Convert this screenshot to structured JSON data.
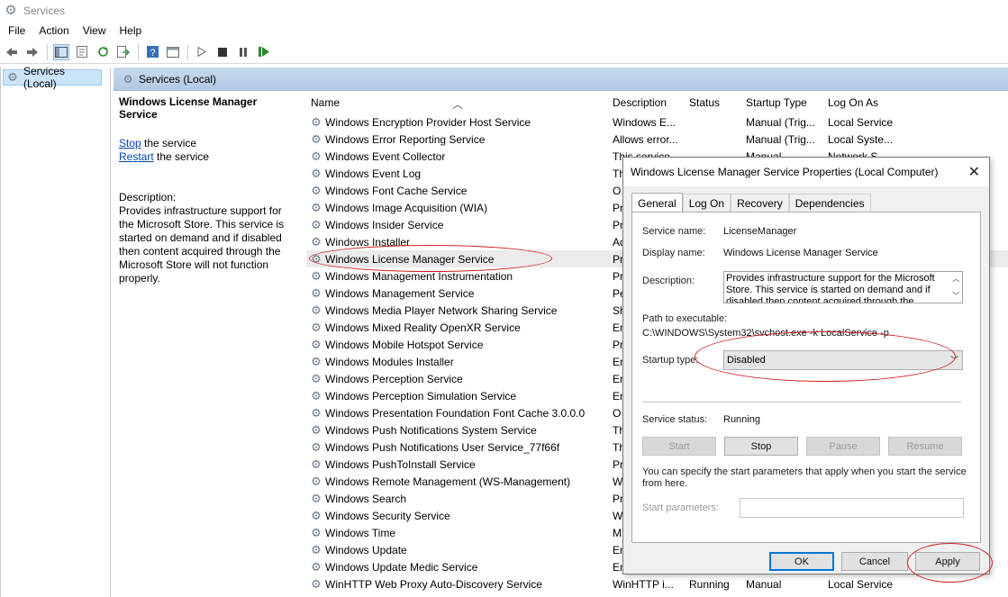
{
  "window": {
    "title": "Services",
    "icon": "gear-icon"
  },
  "menu": [
    "File",
    "Action",
    "View",
    "Help"
  ],
  "toolbar": [
    "back-icon",
    "forward-icon",
    "show-tree-icon",
    "properties-icon",
    "refresh-icon",
    "export-icon",
    "help-icon",
    "view-icon",
    "play-icon",
    "stop-icon",
    "pause-icon",
    "resume-icon"
  ],
  "tree": {
    "item": "Services (Local)"
  },
  "pane": {
    "header": "Services (Local)"
  },
  "detail": {
    "title": "Windows License Manager Service",
    "stop_link": "Stop",
    "stop_rest": " the service",
    "restart_link": "Restart",
    "restart_rest": " the service",
    "desc_label": "Description:",
    "desc_text": "Provides infrastructure support for the Microsoft Store.  This service is started on demand and if disabled then content acquired through the Microsoft Store will not function properly."
  },
  "columns": {
    "name": "Name",
    "description": "Description",
    "status": "Status",
    "startup": "Startup Type",
    "logon": "Log On As"
  },
  "services": [
    {
      "name": "Windows Encryption Provider Host Service",
      "desc": "Windows E...",
      "status": "",
      "startup": "Manual (Trig...",
      "logon": "Local Service"
    },
    {
      "name": "Windows Error Reporting Service",
      "desc": "Allows error...",
      "status": "",
      "startup": "Manual (Trig...",
      "logon": "Local Syste..."
    },
    {
      "name": "Windows Event Collector",
      "desc": "This service",
      "status": "",
      "startup": "Manual",
      "logon": "Network S..."
    },
    {
      "name": "Windows Event Log",
      "desc": "Th",
      "status": "",
      "startup": "",
      "logon": ""
    },
    {
      "name": "Windows Font Cache Service",
      "desc": "O",
      "status": "",
      "startup": "",
      "logon": ""
    },
    {
      "name": "Windows Image Acquisition (WIA)",
      "desc": "Pr",
      "status": "",
      "startup": "",
      "logon": ""
    },
    {
      "name": "Windows Insider Service",
      "desc": "Pr",
      "status": "",
      "startup": "",
      "logon": ""
    },
    {
      "name": "Windows Installer",
      "desc": "Ad",
      "status": "",
      "startup": "",
      "logon": ""
    },
    {
      "name": "Windows License Manager Service",
      "desc": "Pr",
      "status": "",
      "startup": "",
      "logon": ""
    },
    {
      "name": "Windows Management Instrumentation",
      "desc": "Pr",
      "status": "",
      "startup": "",
      "logon": ""
    },
    {
      "name": "Windows Management Service",
      "desc": "Pe",
      "status": "",
      "startup": "",
      "logon": ""
    },
    {
      "name": "Windows Media Player Network Sharing Service",
      "desc": "Sh",
      "status": "",
      "startup": "",
      "logon": ""
    },
    {
      "name": "Windows Mixed Reality OpenXR Service",
      "desc": "En",
      "status": "",
      "startup": "",
      "logon": ""
    },
    {
      "name": "Windows Mobile Hotspot Service",
      "desc": "Pr",
      "status": "",
      "startup": "",
      "logon": ""
    },
    {
      "name": "Windows Modules Installer",
      "desc": "En",
      "status": "",
      "startup": "",
      "logon": ""
    },
    {
      "name": "Windows Perception Service",
      "desc": "En",
      "status": "",
      "startup": "",
      "logon": ""
    },
    {
      "name": "Windows Perception Simulation Service",
      "desc": "En",
      "status": "",
      "startup": "",
      "logon": ""
    },
    {
      "name": "Windows Presentation Foundation Font Cache 3.0.0.0",
      "desc": "O",
      "status": "",
      "startup": "",
      "logon": ""
    },
    {
      "name": "Windows Push Notifications System Service",
      "desc": "Th",
      "status": "",
      "startup": "",
      "logon": ""
    },
    {
      "name": "Windows Push Notifications User Service_77f66f",
      "desc": "Th",
      "status": "",
      "startup": "",
      "logon": ""
    },
    {
      "name": "Windows PushToInstall Service",
      "desc": "Pr",
      "status": "",
      "startup": "",
      "logon": ""
    },
    {
      "name": "Windows Remote Management (WS-Management)",
      "desc": "W",
      "status": "",
      "startup": "",
      "logon": ""
    },
    {
      "name": "Windows Search",
      "desc": "Pr",
      "status": "",
      "startup": "",
      "logon": ""
    },
    {
      "name": "Windows Security Service",
      "desc": "W",
      "status": "",
      "startup": "",
      "logon": ""
    },
    {
      "name": "Windows Time",
      "desc": "M",
      "status": "",
      "startup": "",
      "logon": ""
    },
    {
      "name": "Windows Update",
      "desc": "En",
      "status": "",
      "startup": "",
      "logon": ""
    },
    {
      "name": "Windows Update Medic Service",
      "desc": "En",
      "status": "",
      "startup": "",
      "logon": ""
    },
    {
      "name": "WinHTTP Web Proxy Auto-Discovery Service",
      "desc": "WinHTTP i...",
      "status": "Running",
      "startup": "Manual",
      "logon": "Local Service"
    }
  ],
  "dialog": {
    "title": "Windows License Manager Service Properties (Local Computer)",
    "tabs": [
      "General",
      "Log On",
      "Recovery",
      "Dependencies"
    ],
    "service_name_label": "Service name:",
    "service_name": "LicenseManager",
    "display_name_label": "Display name:",
    "display_name": "Windows License Manager Service",
    "description_label": "Description:",
    "description": "Provides infrastructure support for the Microsoft Store.  This service is started on demand and if disabled then content acquired through the",
    "path_label": "Path to executable:",
    "path": "C:\\WINDOWS\\System32\\svchost.exe -k LocalService -p",
    "startup_label": "Startup type:",
    "startup_value": "Disabled",
    "status_label": "Service status:",
    "status_value": "Running",
    "btn_start": "Start",
    "btn_stop": "Stop",
    "btn_pause": "Pause",
    "btn_resume": "Resume",
    "params_note": "You can specify the start parameters that apply when you start the service from here.",
    "params_label": "Start parameters:",
    "params_value": "",
    "ok": "OK",
    "cancel": "Cancel",
    "apply": "Apply"
  },
  "annotations": {
    "color": "#d02020"
  }
}
